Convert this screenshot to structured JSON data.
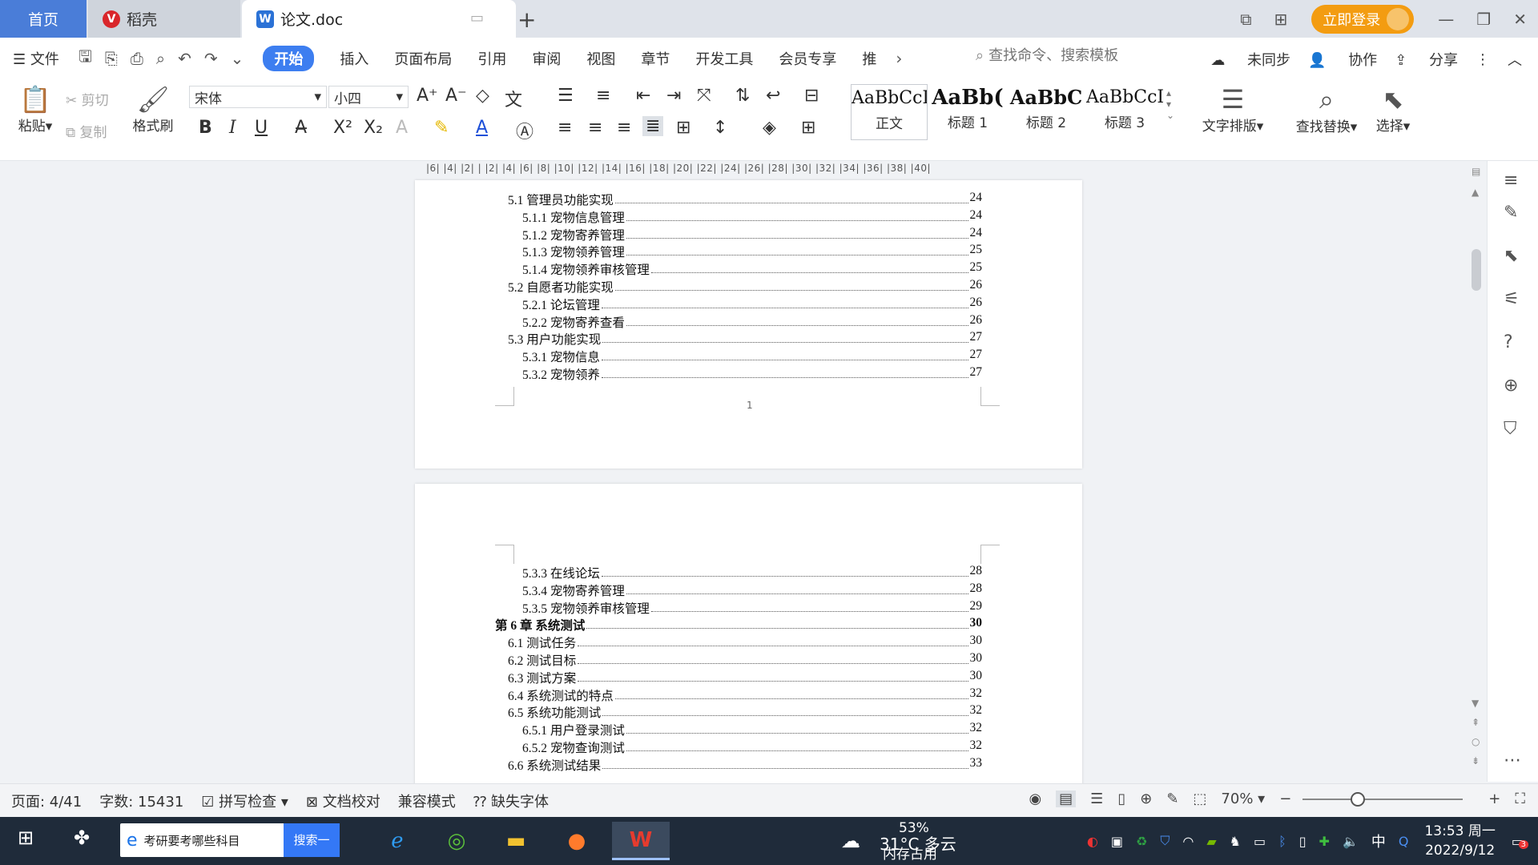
{
  "titlebar": {
    "tabs": [
      {
        "label": "首页"
      },
      {
        "label": "稻壳"
      },
      {
        "label": "论文.doc"
      }
    ],
    "login_label": "立即登录"
  },
  "menubar": {
    "file_label": "文件",
    "items": [
      "开始",
      "插入",
      "页面布局",
      "引用",
      "审阅",
      "视图",
      "章节",
      "开发工具",
      "会员专享",
      "推"
    ],
    "search_placeholder": "查找命令、搜索模板",
    "sync_label": "未同步",
    "collab_label": "协作",
    "share_label": "分享"
  },
  "ribbon": {
    "paste": "粘贴",
    "cut": "剪切",
    "copy": "复制",
    "format_painter": "格式刷",
    "font_name": "宋体",
    "font_size": "小四",
    "styles": [
      {
        "preview": "AaBbCcI",
        "label": "正文"
      },
      {
        "preview": "AaBb(",
        "label": "标题 1"
      },
      {
        "preview": "AaBbC",
        "label": "标题 2"
      },
      {
        "preview": "AaBbCcI",
        "label": "标题 3"
      }
    ],
    "text_layout": "文字排版",
    "find_replace": "查找替换",
    "select": "选择"
  },
  "ruler": {
    "ticks": "|6| |4| |2| |  |2| |4| |6| |8| |10| |12| |14| |16| |18| |20| |22| |24| |26| |28| |30| |32| |34| |36| |38| |40|"
  },
  "document": {
    "page1": [
      {
        "text": "5.1 管理员功能实现",
        "page": "24",
        "level": 2
      },
      {
        "text": "5.1.1  宠物信息管理",
        "page": "24",
        "level": 3
      },
      {
        "text": "5.1.2  宠物寄养管理",
        "page": "24",
        "level": 3
      },
      {
        "text": "5.1.3  宠物领养管理",
        "page": "25",
        "level": 3
      },
      {
        "text": "5.1.4  宠物领养审核管理",
        "page": "25",
        "level": 3
      },
      {
        "text": "5.2 自愿者功能实现",
        "page": "26",
        "level": 2
      },
      {
        "text": "5.2.1  论坛管理",
        "page": "26",
        "level": 3
      },
      {
        "text": "5.2.2  宠物寄养查看",
        "page": "26",
        "level": 3
      },
      {
        "text": "5.3 用户功能实现",
        "page": "27",
        "level": 2
      },
      {
        "text": "5.3.1  宠物信息",
        "page": "27",
        "level": 3
      },
      {
        "text": "5.3.2  宠物领养",
        "page": "27",
        "level": 3
      }
    ],
    "page1_footer_mark": "1",
    "page2": [
      {
        "text": "5.3.3  在线论坛",
        "page": "28",
        "level": 3
      },
      {
        "text": "5.3.4  宠物寄养管理",
        "page": "28",
        "level": 3
      },
      {
        "text": "5.3.5  宠物领养审核管理",
        "page": "29",
        "level": 3
      },
      {
        "text": "第 6 章  系统测试",
        "page": "30",
        "level": 1
      },
      {
        "text": "6.1 测试任务",
        "page": "30",
        "level": 2
      },
      {
        "text": "6.2 测试目标",
        "page": "30",
        "level": 2
      },
      {
        "text": "6.3 测试方案",
        "page": "30",
        "level": 2
      },
      {
        "text": "6.4 系统测试的特点",
        "page": "32",
        "level": 2
      },
      {
        "text": "6.5 系统功能测试",
        "page": "32",
        "level": 2
      },
      {
        "text": "6.5.1  用户登录测试",
        "page": "32",
        "level": 3
      },
      {
        "text": "6.5.2  宠物查询测试",
        "page": "32",
        "level": 3
      },
      {
        "text": "6.6 系统测试结果",
        "page": "33",
        "level": 2
      }
    ]
  },
  "statusbar": {
    "page": "页面: 4/41",
    "words": "字数: 15431",
    "spell": "拼写检查",
    "proof": "文档校对",
    "compat": "兼容模式",
    "missing_font": "缺失字体",
    "zoom": "70%"
  },
  "taskbar": {
    "search_text": "考研要考哪些科目",
    "search_button": "搜索一下",
    "weather": "31°C 多云",
    "memory_pct": "53%",
    "memory_label": "内存占用",
    "ime": "中",
    "time": "13:53 周一",
    "date": "2022/9/12",
    "badge": "3"
  },
  "colors": {
    "accent": "#3d7ef0",
    "home_tab": "#4a7dd8",
    "login": "#f39c11",
    "taskbar": "#1f2b3a"
  }
}
